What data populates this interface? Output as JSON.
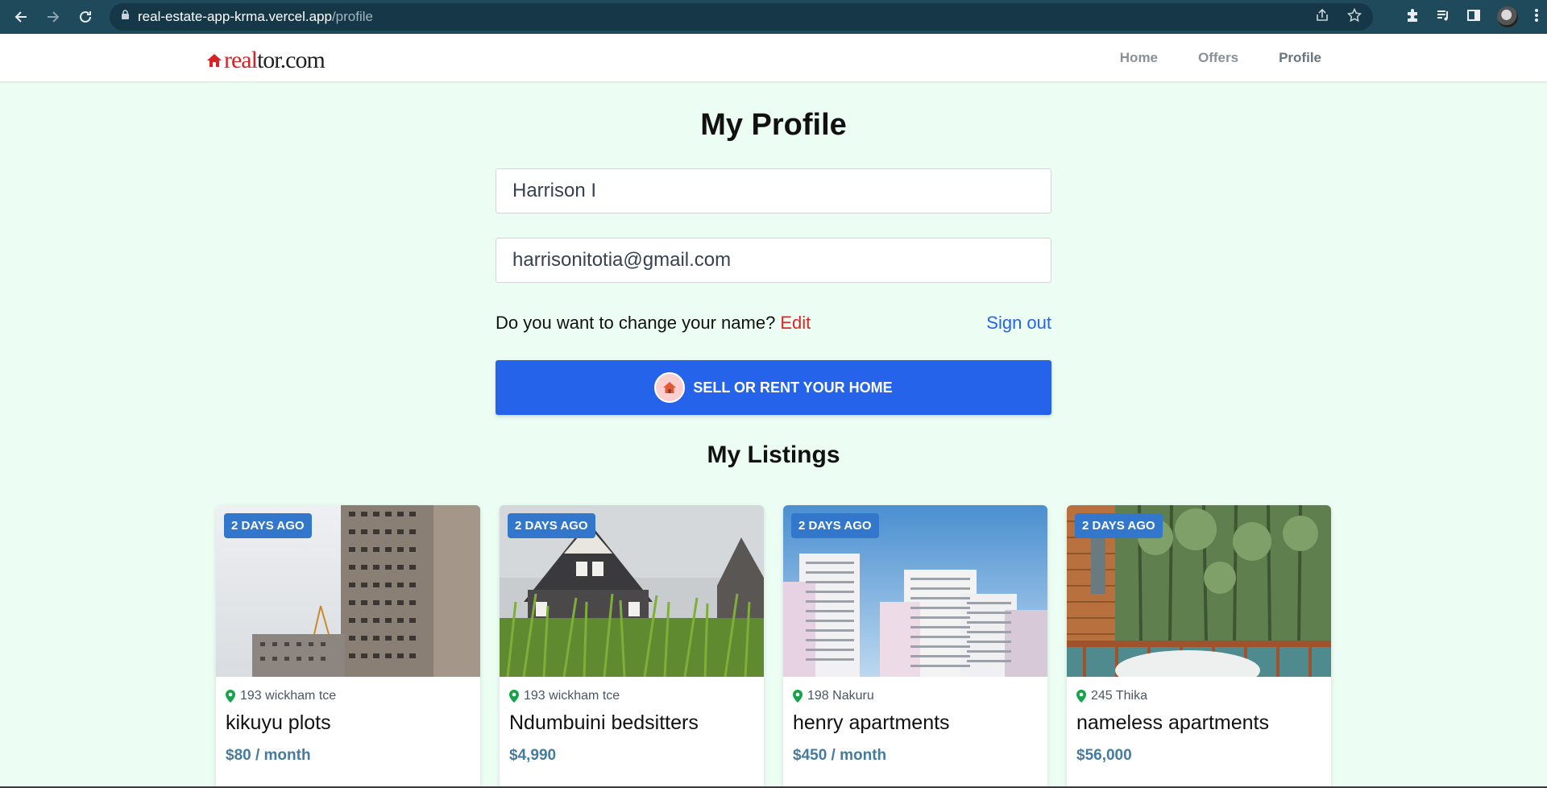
{
  "browser": {
    "url_host": "real-estate-app-krma.vercel.app",
    "url_path": "/profile"
  },
  "header": {
    "logo_real": "real",
    "logo_rest": "tor.com",
    "nav": [
      {
        "label": "Home"
      },
      {
        "label": "Offers"
      },
      {
        "label": "Profile"
      }
    ]
  },
  "profile": {
    "title": "My Profile",
    "name_value": "Harrison I",
    "email_value": "harrisonitotia@gmail.com",
    "change_question": "Do you want to change your name?",
    "edit_label": "Edit",
    "signout_label": "Sign out",
    "sell_button_label": "Sell or rent your home"
  },
  "listings": {
    "title": "My Listings",
    "items": [
      {
        "badge": "2 days ago",
        "address": "193 wickham tce",
        "name": "kikuyu plots",
        "price": "$80 / month"
      },
      {
        "badge": "2 days ago",
        "address": "193 wickham tce",
        "name": "Ndumbuini bedsitters",
        "price": "$4,990"
      },
      {
        "badge": "2 days ago",
        "address": "198 Nakuru",
        "name": "henry apartments",
        "price": "$450 / month"
      },
      {
        "badge": "2 days ago",
        "address": "245 Thika",
        "name": "nameless apartments",
        "price": "$56,000"
      }
    ]
  },
  "colors": {
    "page_bg": "#ecfdf3",
    "primary": "#2563eb",
    "edit_red": "#dc2626",
    "badge_blue": "#3377cc",
    "price_blue": "#457b9d",
    "pin_green": "#16a34a"
  }
}
